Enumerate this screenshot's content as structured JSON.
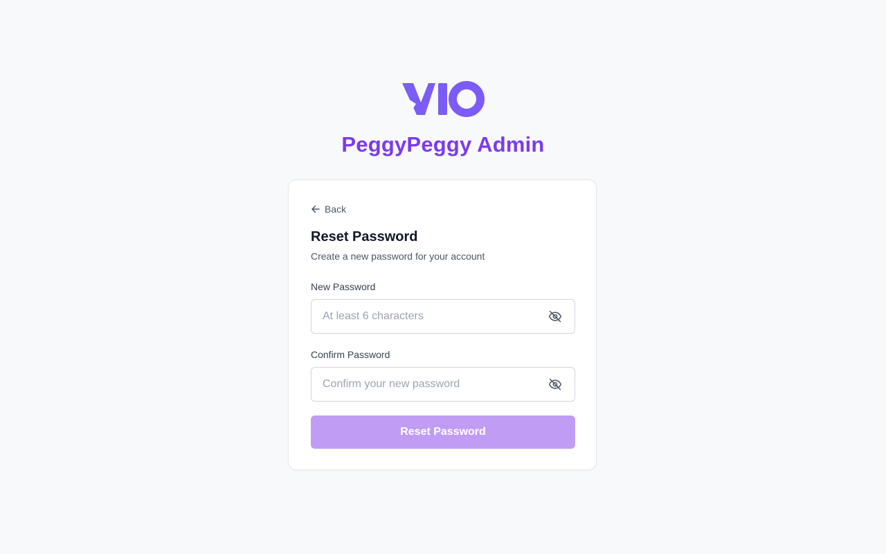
{
  "brand": {
    "logo_text": "VIO",
    "logo_icon": "vio-logo",
    "app_title": "PeggyPeggy Admin"
  },
  "colors": {
    "brand": "#7c3aed",
    "logo": "#7b5cf6",
    "button": "#c09cf5",
    "background": "#f8f9fb"
  },
  "card": {
    "back_label": "Back",
    "back_icon": "arrow-left-icon",
    "title": "Reset Password",
    "subtitle": "Create a new password for your account",
    "fields": [
      {
        "label": "New Password",
        "placeholder": "At least 6 characters",
        "value": "",
        "toggle_icon": "eye-off-icon"
      },
      {
        "label": "Confirm Password",
        "placeholder": "Confirm your new password",
        "value": "",
        "toggle_icon": "eye-off-icon"
      }
    ],
    "submit_label": "Reset Password"
  }
}
